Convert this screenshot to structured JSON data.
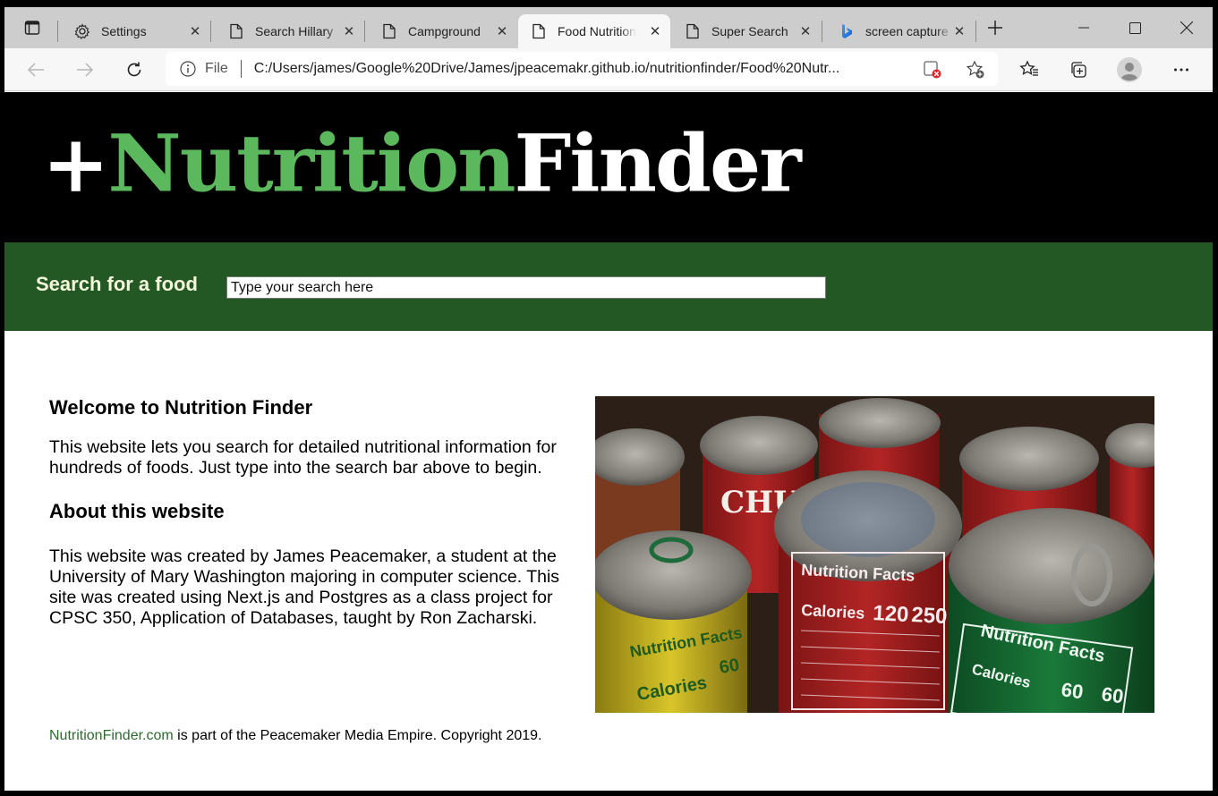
{
  "browser": {
    "tabs": [
      {
        "title": "Settings",
        "icon": "gear-icon",
        "active": false
      },
      {
        "title": "Search Hillary",
        "icon": "page-icon",
        "active": false
      },
      {
        "title": "Campground",
        "icon": "page-icon",
        "active": false
      },
      {
        "title": "Food Nutrition",
        "icon": "page-icon",
        "active": true
      },
      {
        "title": "Super Search",
        "icon": "page-icon",
        "active": false
      },
      {
        "title": "screen capture",
        "icon": "bing-icon",
        "active": false
      }
    ],
    "new_tab_label": "+",
    "close_glyph": "✕",
    "address": {
      "scheme": "File",
      "url": "C:/Users/james/Google%20Drive/James/jpeacemakr.github.io/nutritionfinder/Food%20Nutr..."
    },
    "window_controls": [
      "minimize",
      "maximize",
      "close"
    ]
  },
  "site": {
    "logo": {
      "plus": "+",
      "part1": "Nutrition",
      "part2": "Finder"
    },
    "colors": {
      "logo_green": "#5cb85c",
      "band_green": "#235723",
      "label_cream": "#f4f9dc",
      "link_green": "#2e6b2e"
    },
    "search": {
      "label": "Search for a food",
      "placeholder": "Type your search here",
      "value": ""
    },
    "welcome": {
      "heading": "Welcome to Nutrition Finder",
      "body": "This website lets you search for detailed nutritional information for hundreds of foods. Just type into the search bar above to begin."
    },
    "about": {
      "heading": "About this website",
      "body": "This website was created by James Peacemaker, a student at the University of Mary Washington majoring in computer science. This site was created using Next.js and Postgres as a class project for CPSC 350, Application of Databases, taught by Ron Zacharski."
    },
    "photo": {
      "description": "Photo of soup cans showing Nutrition Facts labels",
      "label_texts": [
        "Nutrition Facts",
        "Calories",
        "120",
        "250",
        "60",
        "60"
      ]
    },
    "footer": {
      "link": "NutritionFinder.com",
      "text": " is part of the Peacemaker Media Empire. Copyright 2019."
    }
  }
}
